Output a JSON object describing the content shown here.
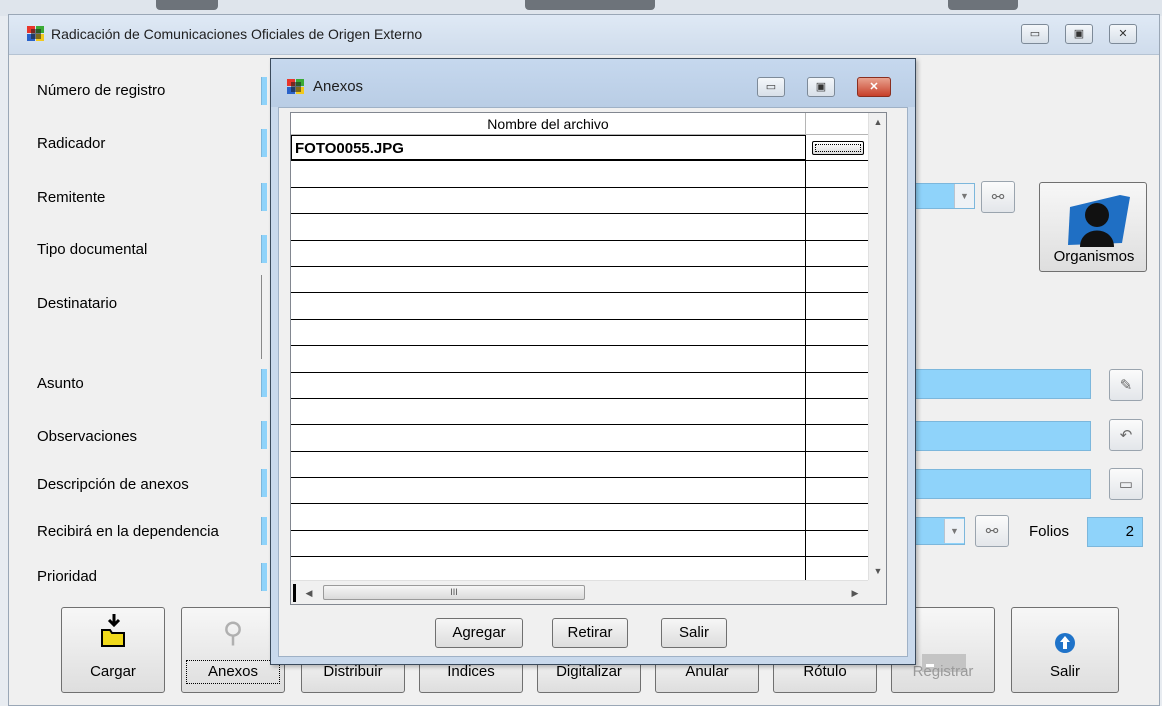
{
  "main_window": {
    "title": "Radicación de Comunicaciones Oficiales de Origen Externo",
    "controls": {
      "minimize": "▭",
      "maximize": "▣",
      "close": "✕"
    }
  },
  "form": {
    "labels": {
      "numero_registro": "Número de registro",
      "radicador": "Radicador",
      "remitente": "Remitente",
      "tipo_documental": "Tipo documental",
      "destinatario": "Destinatario",
      "asunto": "Asunto",
      "observaciones": "Observaciones",
      "descripcion_anexos": "Descripción de anexos",
      "recibira_dependencia": "Recibirá en la dependencia",
      "prioridad": "Prioridad",
      "folios": "Folios"
    },
    "folios_value": "2",
    "organismos_label": "Organismos"
  },
  "toolbar": {
    "buttons": [
      {
        "label": "Cargar"
      },
      {
        "label": "Anexos"
      },
      {
        "label": "Distribuir"
      },
      {
        "label": "Indices"
      },
      {
        "label": "Digitalizar"
      },
      {
        "label": "Anular"
      },
      {
        "label": "Rótulo"
      },
      {
        "label": "Registrar"
      },
      {
        "label": "Salir"
      }
    ]
  },
  "dialog": {
    "title": "Anexos",
    "column_header": "Nombre del archivo",
    "rows": [
      {
        "name": "FOTO0055.JPG"
      },
      {
        "name": ""
      },
      {
        "name": ""
      },
      {
        "name": ""
      },
      {
        "name": ""
      },
      {
        "name": ""
      },
      {
        "name": ""
      },
      {
        "name": ""
      },
      {
        "name": ""
      },
      {
        "name": ""
      },
      {
        "name": ""
      },
      {
        "name": ""
      },
      {
        "name": ""
      },
      {
        "name": ""
      },
      {
        "name": ""
      },
      {
        "name": ""
      },
      {
        "name": ""
      }
    ],
    "hscroll_grip": "III",
    "buttons": {
      "agregar": "Agregar",
      "retirar": "Retirar",
      "salir": "Salir"
    }
  },
  "colors": {
    "field_bg": "#8fd3fa",
    "dialog_frame": "#c9d9ec",
    "close_red": "#c7402a"
  }
}
